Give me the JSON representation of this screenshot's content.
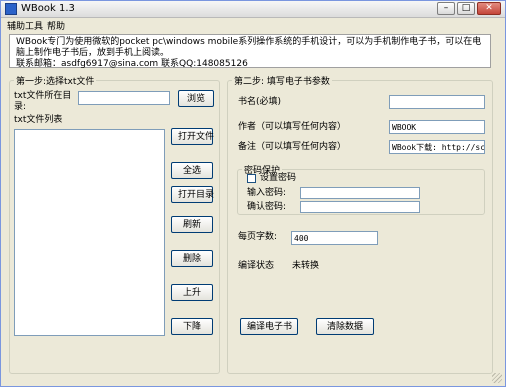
{
  "window": {
    "title": "WBook 1.3"
  },
  "menu": {
    "tools": "辅助工具",
    "help": "帮助"
  },
  "info_text": "WBook专门为使用微软的pocket pc\\windows mobile系列操作系统的手机设计，可以为手机制作电子书，可以在电脑上制作电子书后，放到手机上阅读。\n联系邮箱：asdfg6917@sina.com  联系QQ:148085126",
  "step1": {
    "legend": "第一步:选择txt文件",
    "dir_label": "txt文件所在目录:",
    "dir_value": "",
    "browse": "浏览",
    "list_label": "txt文件列表",
    "open_file": "打开文件",
    "select_all": "全选",
    "open_dir": "打开目录",
    "refresh": "刷新",
    "delete": "删除",
    "move_up": "上升",
    "move_down": "下降"
  },
  "step2": {
    "legend": "第二步: 填写电子书参数",
    "book_name_label": "书名(必填)",
    "book_name_value": "",
    "author_label": "作者（可以填写任何内容）",
    "author_value": "WBOOK",
    "remark_label": "备注（可以填写任何内容）",
    "remark_value": "WBook下载: http://sc",
    "password": {
      "legend": "密码保护",
      "set_label": "设置密码",
      "set_checked": false,
      "input_label": "输入密码:",
      "input_value": "",
      "confirm_label": "确认密码:",
      "confirm_value": ""
    },
    "per_page_label": "每页字数:",
    "per_page_value": "400",
    "status_label": "编译状态",
    "status_value": "未转换",
    "compile_btn": "编译电子书",
    "clear_btn": "清除数据"
  }
}
